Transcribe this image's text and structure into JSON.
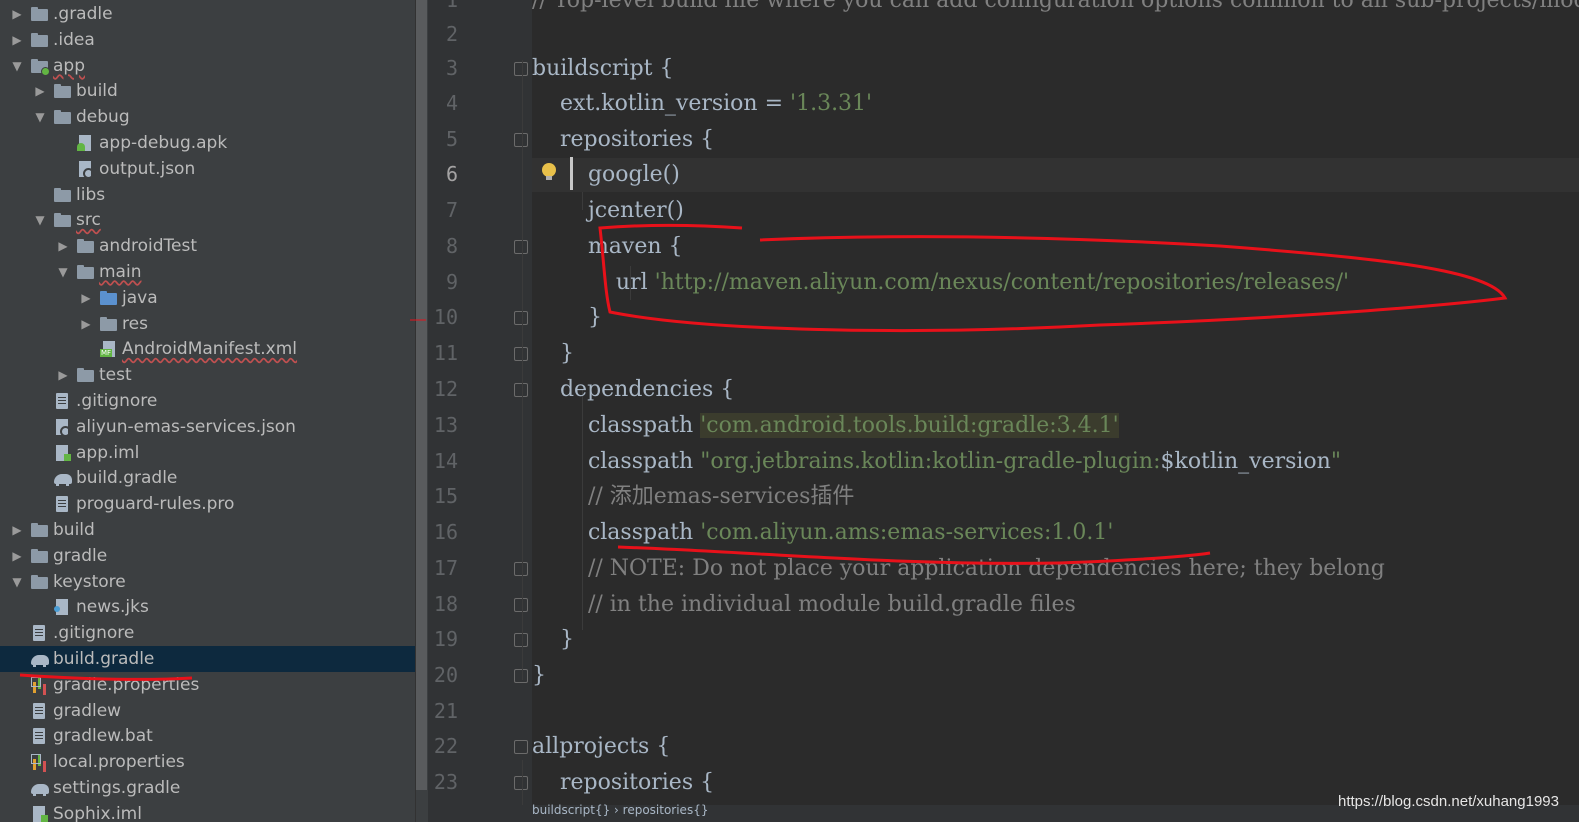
{
  "project_tree": {
    "items": [
      {
        "label": ".gradle",
        "arrow": "▶",
        "icon": "folder-icon"
      },
      {
        "label": ".idea",
        "arrow": "▶",
        "icon": "folder-icon"
      },
      {
        "label": "app",
        "arrow": "▼",
        "icon": "module-folder-icon"
      },
      {
        "label": "build",
        "arrow": "▶",
        "icon": "folder-icon"
      },
      {
        "label": "debug",
        "arrow": "▼",
        "icon": "folder-icon"
      },
      {
        "label": "app-debug.apk",
        "arrow": "",
        "icon": "apk-file-icon"
      },
      {
        "label": "output.json",
        "arrow": "",
        "icon": "json-file-icon"
      },
      {
        "label": "libs",
        "arrow": "",
        "icon": "folder-icon"
      },
      {
        "label": "src",
        "arrow": "▼",
        "icon": "folder-icon"
      },
      {
        "label": "androidTest",
        "arrow": "▶",
        "icon": "folder-icon"
      },
      {
        "label": "main",
        "arrow": "▼",
        "icon": "folder-icon"
      },
      {
        "label": "java",
        "arrow": "▶",
        "icon": "source-folder-icon"
      },
      {
        "label": "res",
        "arrow": "▶",
        "icon": "resource-folder-icon"
      },
      {
        "label": "AndroidManifest.xml",
        "arrow": "",
        "icon": "manifest-file-icon"
      },
      {
        "label": "test",
        "arrow": "▶",
        "icon": "folder-icon"
      },
      {
        "label": ".gitignore",
        "arrow": "",
        "icon": "text-file-icon"
      },
      {
        "label": "aliyun-emas-services.json",
        "arrow": "",
        "icon": "json-file-icon"
      },
      {
        "label": "app.iml",
        "arrow": "",
        "icon": "iml-file-icon"
      },
      {
        "label": "build.gradle",
        "arrow": "",
        "icon": "gradle-file-icon"
      },
      {
        "label": "proguard-rules.pro",
        "arrow": "",
        "icon": "text-file-icon"
      },
      {
        "label": "build",
        "arrow": "▶",
        "icon": "folder-icon"
      },
      {
        "label": "gradle",
        "arrow": "▶",
        "icon": "folder-icon"
      },
      {
        "label": "keystore",
        "arrow": "▼",
        "icon": "folder-icon"
      },
      {
        "label": "news.jks",
        "arrow": "",
        "icon": "keystore-file-icon"
      },
      {
        "label": ".gitignore",
        "arrow": "",
        "icon": "text-file-icon"
      },
      {
        "label": "build.gradle",
        "arrow": "",
        "icon": "gradle-file-icon"
      },
      {
        "label": "gradle.properties",
        "arrow": "",
        "icon": "properties-file-icon"
      },
      {
        "label": "gradlew",
        "arrow": "",
        "icon": "text-file-icon"
      },
      {
        "label": "gradlew.bat",
        "arrow": "",
        "icon": "text-file-icon"
      },
      {
        "label": "local.properties",
        "arrow": "",
        "icon": "properties-file-icon"
      },
      {
        "label": "settings.gradle",
        "arrow": "",
        "icon": "gradle-file-icon"
      },
      {
        "label": "Sophix.iml",
        "arrow": "",
        "icon": "iml-file-icon"
      }
    ],
    "selected_item": "build.gradle"
  },
  "editor": {
    "current_line": "6",
    "line_numbers": [
      "1",
      "2",
      "3",
      "4",
      "5",
      "6",
      "7",
      "8",
      "9",
      "10",
      "11",
      "12",
      "13",
      "14",
      "15",
      "16",
      "17",
      "18",
      "19",
      "20",
      "21",
      "22",
      "23"
    ],
    "lines": {
      "l1": "// Top-level build file where you can add configuration options common to all sub-projects/modules.",
      "l2": "",
      "l3": "buildscript {",
      "l4a": "    ext.kotlin_version = ",
      "l4b": "'1.3.31'",
      "l5": "    repositories {",
      "l6": "        google()",
      "l7": "        jcenter()",
      "l8": "        maven {",
      "l9a": "            url ",
      "l9b": "'http://maven.aliyun.com/nexus/content/repositories/releases/'",
      "l10": "        }",
      "l11": "    }",
      "l12": "    dependencies {",
      "l13a": "        classpath ",
      "l13b": "'com.android.tools.build:gradle:3.4.1'",
      "l14a": "        classpath ",
      "l14b": "\"org.jetbrains.kotlin:kotlin-gradle-plugin:",
      "l14c": "$kotlin_version",
      "l14d": "\"",
      "l15": "        // 添加emas-services插件",
      "l16a": "        classpath ",
      "l16b": "'com.aliyun.ams:emas-services:1.0.1'",
      "l17": "        // NOTE: Do not place your application dependencies here; they belong",
      "l18": "        // in the individual module build.gradle files",
      "l19": "    }",
      "l20": "}",
      "l21": "",
      "l22": "allprojects {",
      "l23": "    repositories {"
    }
  },
  "breadcrumb": "buildscript{} › repositories{}",
  "watermark": "https://blog.csdn.net/xuhang1993",
  "colors": {
    "annotation_red": "#e8111a",
    "string_green": "#6a8759",
    "selection_blue": "#0d293e"
  }
}
